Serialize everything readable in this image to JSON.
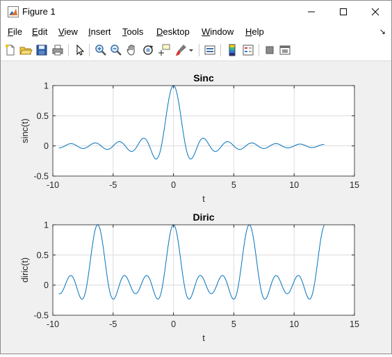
{
  "window": {
    "title": "Figure 1",
    "minimize_label": "—",
    "maximize_label": "☐",
    "close_label": "✕"
  },
  "menu": {
    "items": [
      {
        "first": "F",
        "rest": "ile"
      },
      {
        "first": "E",
        "rest": "dit"
      },
      {
        "first": "V",
        "rest": "iew"
      },
      {
        "first": "I",
        "rest": "nsert"
      },
      {
        "first": "T",
        "rest": "ools"
      },
      {
        "first": "D",
        "rest": "esktop"
      },
      {
        "first": "W",
        "rest": "indow"
      },
      {
        "first": "H",
        "rest": "elp"
      }
    ],
    "dock_label": "↘"
  },
  "toolbar": {
    "buttons": [
      "new-figure-icon",
      "open-file-icon",
      "save-icon",
      "print-icon",
      "pointer-icon",
      "zoom-in-icon",
      "zoom-out-icon",
      "pan-icon",
      "rotate-3d-icon",
      "data-cursor-icon",
      "brush-icon",
      "link-plot-icon",
      "colorbar-icon",
      "legend-icon",
      "hide-plot-tools-icon",
      "show-plot-tools-icon"
    ]
  },
  "colors": {
    "line": "#0072bd",
    "grid": "#dcdcdc",
    "axes_bg": "#ffffff"
  },
  "chart_data": [
    {
      "type": "line",
      "title": "Sinc",
      "xlabel": "t",
      "ylabel": "sinc(t)",
      "xlim": [
        -10,
        15
      ],
      "ylim": [
        -0.5,
        1
      ],
      "xticks": [
        "-10",
        "-5",
        "0",
        "5",
        "10",
        "15"
      ],
      "yticks": [
        "-0.5",
        "0",
        "0.5",
        "1"
      ],
      "x_range": [
        -9.5,
        12.5
      ],
      "function": "sinc",
      "grid": true
    },
    {
      "type": "line",
      "title": "Diric",
      "xlabel": "t",
      "ylabel": "diric(t)",
      "xlim": [
        -10,
        15
      ],
      "ylim": [
        -0.5,
        1
      ],
      "xticks": [
        "-10",
        "-5",
        "0",
        "5",
        "10",
        "15"
      ],
      "yticks": [
        "-0.5",
        "0",
        "0.5",
        "1"
      ],
      "x_range": [
        -9.5,
        12.5
      ],
      "function": "diric",
      "diric_n": 7,
      "grid": true
    }
  ]
}
